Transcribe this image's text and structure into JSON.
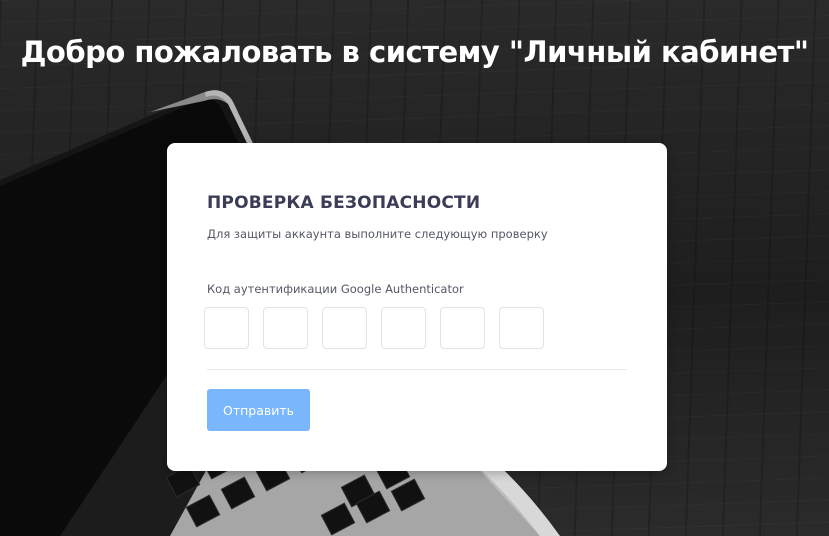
{
  "page": {
    "title": "Добро пожаловать в систему \"Личный кабинет\""
  },
  "card": {
    "title": "ПРОВЕРКА БЕЗОПАСНОСТИ",
    "subtitle": "Для защиты аккаунта выполните следующую проверку",
    "code_label": "Код аутентификации Google Authenticator",
    "code_digits": [
      "",
      "",
      "",
      "",
      "",
      ""
    ],
    "submit_label": "Отправить"
  },
  "colors": {
    "accent": "#7ab6fb",
    "title_text": "#3b3c58",
    "background": "#222222"
  },
  "icons": {
    "background_art": "laptop-photo"
  }
}
